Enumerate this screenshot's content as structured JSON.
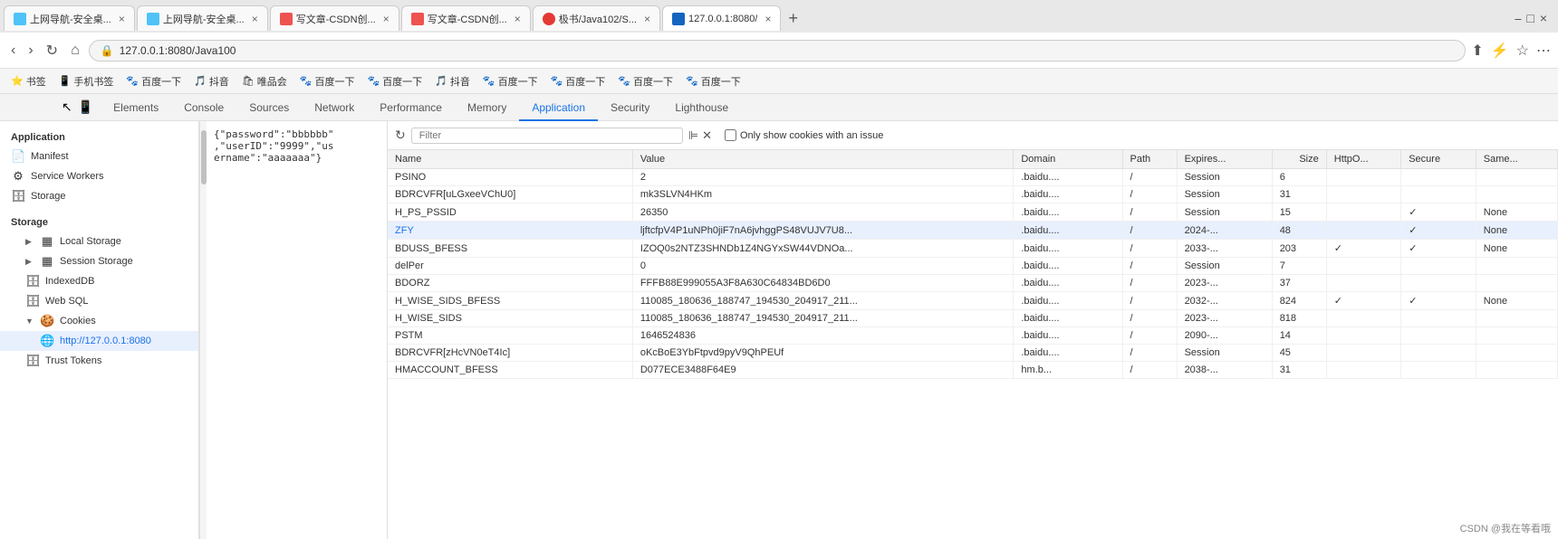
{
  "browser": {
    "tabs": [
      {
        "id": 1,
        "title": "上网导航-安全桌...",
        "favicon_color": "#4fc3f7",
        "active": false
      },
      {
        "id": 2,
        "title": "上网导航-安全桌...",
        "favicon_color": "#4fc3f7",
        "active": false
      },
      {
        "id": 3,
        "title": "写文章-CSDN创...",
        "favicon_color": "#ef5350",
        "active": false
      },
      {
        "id": 4,
        "title": "写文章-CSDN创...",
        "favicon_color": "#ef5350",
        "active": false
      },
      {
        "id": 5,
        "title": "极书/Java102/S...",
        "favicon_color": "#e53935",
        "active": false
      },
      {
        "id": 6,
        "title": "127.0.0.1:8080/",
        "favicon_color": "#1565c0",
        "active": true
      }
    ],
    "url": "127.0.0.1:8080/Java100",
    "protocol_icon": "🔒"
  },
  "bookmarks": [
    {
      "icon": "⭐",
      "label": "书签"
    },
    {
      "icon": "📱",
      "label": "手机书签"
    },
    {
      "icon": "🐾",
      "label": "百度一下"
    },
    {
      "icon": "🎵",
      "label": "抖音"
    },
    {
      "icon": "🛍",
      "label": "唯品会"
    },
    {
      "icon": "🐾",
      "label": "百度一下"
    },
    {
      "icon": "🐾",
      "label": "百度一下"
    },
    {
      "icon": "🎵",
      "label": "抖音"
    },
    {
      "icon": "🐾",
      "label": "百度一下"
    },
    {
      "icon": "🐾",
      "label": "百度一下"
    },
    {
      "icon": "🐾",
      "label": "百度一下"
    },
    {
      "icon": "🐾",
      "label": "百度一下"
    }
  ],
  "devtools": {
    "tabs": [
      "Elements",
      "Console",
      "Sources",
      "Network",
      "Performance",
      "Memory",
      "Application",
      "Security",
      "Lighthouse"
    ],
    "active_tab": "Application"
  },
  "sidebar": {
    "section_application": "Application",
    "items": [
      {
        "id": "manifest",
        "label": "Manifest",
        "icon": "📄",
        "indent": 0
      },
      {
        "id": "service-workers",
        "label": "Service Workers",
        "icon": "⚙",
        "indent": 0
      },
      {
        "id": "storage",
        "label": "Storage",
        "icon": "🗄",
        "indent": 0
      }
    ],
    "section_storage": "Storage",
    "storage_items": [
      {
        "id": "local-storage",
        "label": "Local Storage",
        "icon": "▦",
        "indent": 1,
        "expanded": false
      },
      {
        "id": "session-storage",
        "label": "Session Storage",
        "icon": "▦",
        "indent": 1,
        "expanded": false
      },
      {
        "id": "indexeddb",
        "label": "IndexedDB",
        "icon": "🗄",
        "indent": 1
      },
      {
        "id": "web-sql",
        "label": "Web SQL",
        "icon": "🗄",
        "indent": 1
      },
      {
        "id": "cookies",
        "label": "Cookies",
        "icon": "🍪",
        "indent": 1,
        "expanded": true
      },
      {
        "id": "cookies-local",
        "label": "http://127.0.0.1:8080",
        "icon": "🌐",
        "indent": 2,
        "active": true
      },
      {
        "id": "trust-tokens",
        "label": "Trust Tokens",
        "icon": "🗄",
        "indent": 1
      }
    ]
  },
  "cookie_toolbar": {
    "filter_placeholder": "Filter",
    "checkbox_label": "Only show cookies with an issue"
  },
  "table": {
    "columns": [
      "Name",
      "Value",
      "Domain",
      "Path",
      "Expires...",
      "Size",
      "HttpO...",
      "Secure",
      "Same..."
    ],
    "rows": [
      {
        "name": "PSINO",
        "value": "2",
        "domain": ".baidu....",
        "path": "/",
        "expires": "Session",
        "size": "6",
        "httpo": "",
        "secure": "",
        "same": "",
        "selected": false
      },
      {
        "name": "BDRCVFR[uLGxeeVChU0]",
        "value": "mk3SLVN4HKm",
        "domain": ".baidu....",
        "path": "/",
        "expires": "Session",
        "size": "31",
        "httpo": "",
        "secure": "",
        "same": "",
        "selected": false
      },
      {
        "name": "H_PS_PSSID",
        "value": "26350",
        "domain": ".baidu....",
        "path": "/",
        "expires": "Session",
        "size": "15",
        "httpo": "",
        "secure": "✓",
        "same": "None",
        "selected": false
      },
      {
        "name": "ZFY",
        "value": "ljftcfpV4P1uNPh0jiF7nA6jvhggPS48VUJV7U8...",
        "domain": ".baidu....",
        "path": "/",
        "expires": "2024-...",
        "size": "48",
        "httpo": "",
        "secure": "✓",
        "same": "None",
        "selected": true
      },
      {
        "name": "BDUSS_BFESS",
        "value": "IZOQ0s2NTZ3SHNDb1Z4NGYxSW44VDNOa...",
        "domain": ".baidu....",
        "path": "/",
        "expires": "2033-...",
        "size": "203",
        "httpo": "✓",
        "secure": "✓",
        "same": "None",
        "selected": false
      },
      {
        "name": "delPer",
        "value": "0",
        "domain": ".baidu....",
        "path": "/",
        "expires": "Session",
        "size": "7",
        "httpo": "",
        "secure": "",
        "same": "",
        "selected": false
      },
      {
        "name": "BDORZ",
        "value": "FFFB88E999055A3F8A630C64834BD6D0",
        "domain": ".baidu....",
        "path": "/",
        "expires": "2023-...",
        "size": "37",
        "httpo": "",
        "secure": "",
        "same": "",
        "selected": false
      },
      {
        "name": "H_WISE_SIDS_BFESS",
        "value": "110085_180636_188747_194530_204917_211...",
        "domain": ".baidu....",
        "path": "/",
        "expires": "2032-...",
        "size": "824",
        "httpo": "✓",
        "secure": "✓",
        "same": "None",
        "selected": false
      },
      {
        "name": "H_WISE_SIDS",
        "value": "110085_180636_188747_194530_204917_211...",
        "domain": ".baidu....",
        "path": "/",
        "expires": "2023-...",
        "size": "818",
        "httpo": "",
        "secure": "",
        "same": "",
        "selected": false
      },
      {
        "name": "PSTM",
        "value": "1646524836",
        "domain": ".baidu....",
        "path": "/",
        "expires": "2090-...",
        "size": "14",
        "httpo": "",
        "secure": "",
        "same": "",
        "selected": false
      },
      {
        "name": "BDRCVFR[zHcVN0eT4Ic]",
        "value": "oKcBoE3YbFtpvd9pyV9QhPEUf",
        "domain": ".baidu....",
        "path": "/",
        "expires": "Session",
        "size": "45",
        "httpo": "",
        "secure": "",
        "same": "",
        "selected": false
      },
      {
        "name": "HMACCOUNT_BFESS",
        "value": "D077ECE3488F64E9",
        "domain": "hm.b...",
        "path": "/",
        "expires": "2038-...",
        "size": "31",
        "httpo": "",
        "secure": "",
        "same": "",
        "selected": false
      }
    ]
  },
  "json_panel": {
    "content": "{\"password\":\"bbbbbb\"\n,\"userID\":\"9999\",\"us\nername\":\"aaaaaaa\"}"
  },
  "watermark": "CSDN @我在等看哦"
}
